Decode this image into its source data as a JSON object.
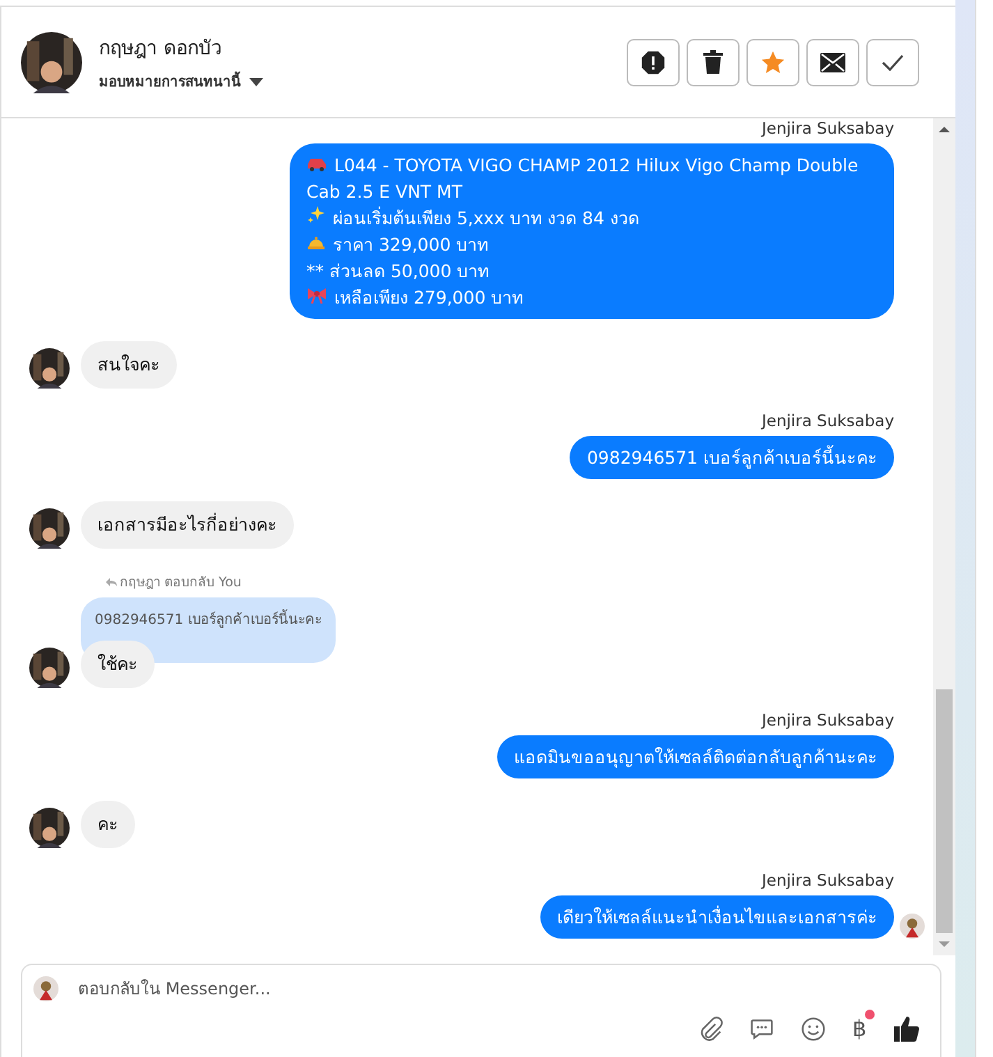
{
  "header": {
    "name": "กฤษฎา ดอกบัว",
    "assign": "มอบหมายการสนทนานี้",
    "actions": [
      {
        "kind": "alert"
      },
      {
        "kind": "trash"
      },
      {
        "kind": "star"
      },
      {
        "kind": "mail"
      },
      {
        "kind": "check"
      }
    ]
  },
  "messages": [
    {
      "kind": "outgoing",
      "sender": "Jenjira Suksabay",
      "lines": [
        {
          "kind": "car",
          "text": "L044 - TOYOTA VIGO CHAMP 2012 Hilux Vigo Champ Double Cab 2.5 E VNT MT"
        },
        {
          "kind": "sparkles",
          "text": "ผ่อนเริ่มต้นเพียง 5,xxx บาท งวด 84 งวด"
        },
        {
          "kind": "bell",
          "text": "ราคา 329,000 บาท"
        },
        {
          "kind": "plain",
          "text": "** ส่วนลด 50,000 บาท"
        },
        {
          "kind": "ribbon",
          "text": "เหลือเพียง 279,000 บาท"
        }
      ],
      "seen": false
    },
    {
      "kind": "incoming",
      "text": "สนใจคะ"
    },
    {
      "kind": "outgoing",
      "sender": "Jenjira Suksabay",
      "lines": [
        {
          "kind": "plain",
          "text": "0982946571 เบอร์ลูกค้าเบอร์นี้นะคะ"
        }
      ],
      "seen": false
    },
    {
      "kind": "incoming",
      "text": "เอกสารมีอะไรกี่อย่างคะ"
    },
    {
      "kind": "incoming",
      "reply_label": "กฤษฎา ตอบกลับ You",
      "quoted": "0982946571 เบอร์ลูกค้าเบอร์นี้นะคะ",
      "text": "ใช้คะ"
    },
    {
      "kind": "outgoing",
      "sender": "Jenjira Suksabay",
      "lines": [
        {
          "kind": "plain",
          "text": "แอดมินขออนุญาตให้เซลล์ติดต่อกลับลูกค้านะคะ"
        }
      ],
      "seen": false
    },
    {
      "kind": "incoming",
      "text": "คะ"
    },
    {
      "kind": "outgoing",
      "sender": "Jenjira Suksabay",
      "lines": [
        {
          "kind": "plain",
          "text": "เดียวให้เซลล์แนะนำเงื่อนไขและเอกสารค่ะ"
        }
      ],
      "seen": true
    }
  ],
  "composer": {
    "placeholder": "ตอบกลับใน Messenger...",
    "tools": [
      {
        "kind": "attach"
      },
      {
        "kind": "chat"
      },
      {
        "kind": "emoji"
      },
      {
        "kind": "currency",
        "symbol": "฿",
        "badge": true
      },
      {
        "kind": "like"
      }
    ]
  }
}
